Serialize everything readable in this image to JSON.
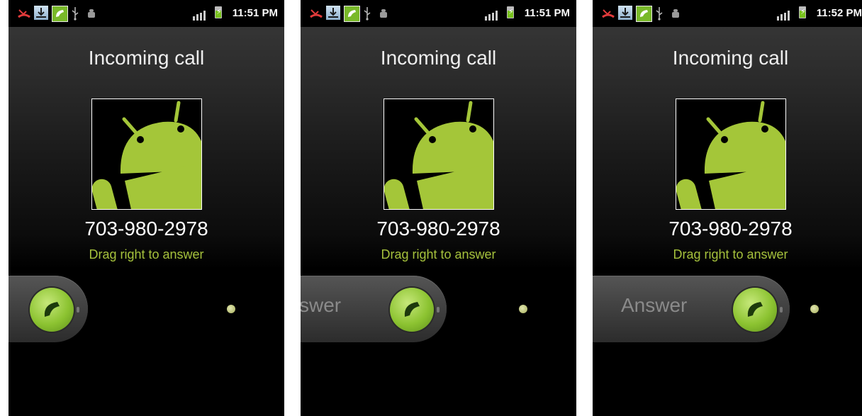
{
  "screens": [
    {
      "status": {
        "time": "11:51 PM"
      },
      "title": "Incoming call",
      "phone_number": "703-980-2978",
      "hint": "Drag right to answer",
      "slider": {
        "label": ""
      }
    },
    {
      "status": {
        "time": "11:51 PM"
      },
      "title": "Incoming call",
      "phone_number": "703-980-2978",
      "hint": "Drag right to answer",
      "slider": {
        "label": "swer"
      }
    },
    {
      "status": {
        "time": "11:52 PM"
      },
      "title": "Incoming call",
      "phone_number": "703-980-2978",
      "hint": "Drag right to answer",
      "slider": {
        "label": "Answer"
      }
    }
  ],
  "icons": {
    "status_bar": [
      "missed-call-icon",
      "download-icon",
      "call-active-icon",
      "usb-icon",
      "debug-icon",
      "signal-icon",
      "battery-charging-icon"
    ],
    "contact_photo": "android-robot-icon",
    "slider_handle": "phone-handset-icon"
  },
  "colors": {
    "hint_text": "#a5c13c",
    "handle": "#8cc331",
    "call_icon_bg": "#79b929"
  }
}
